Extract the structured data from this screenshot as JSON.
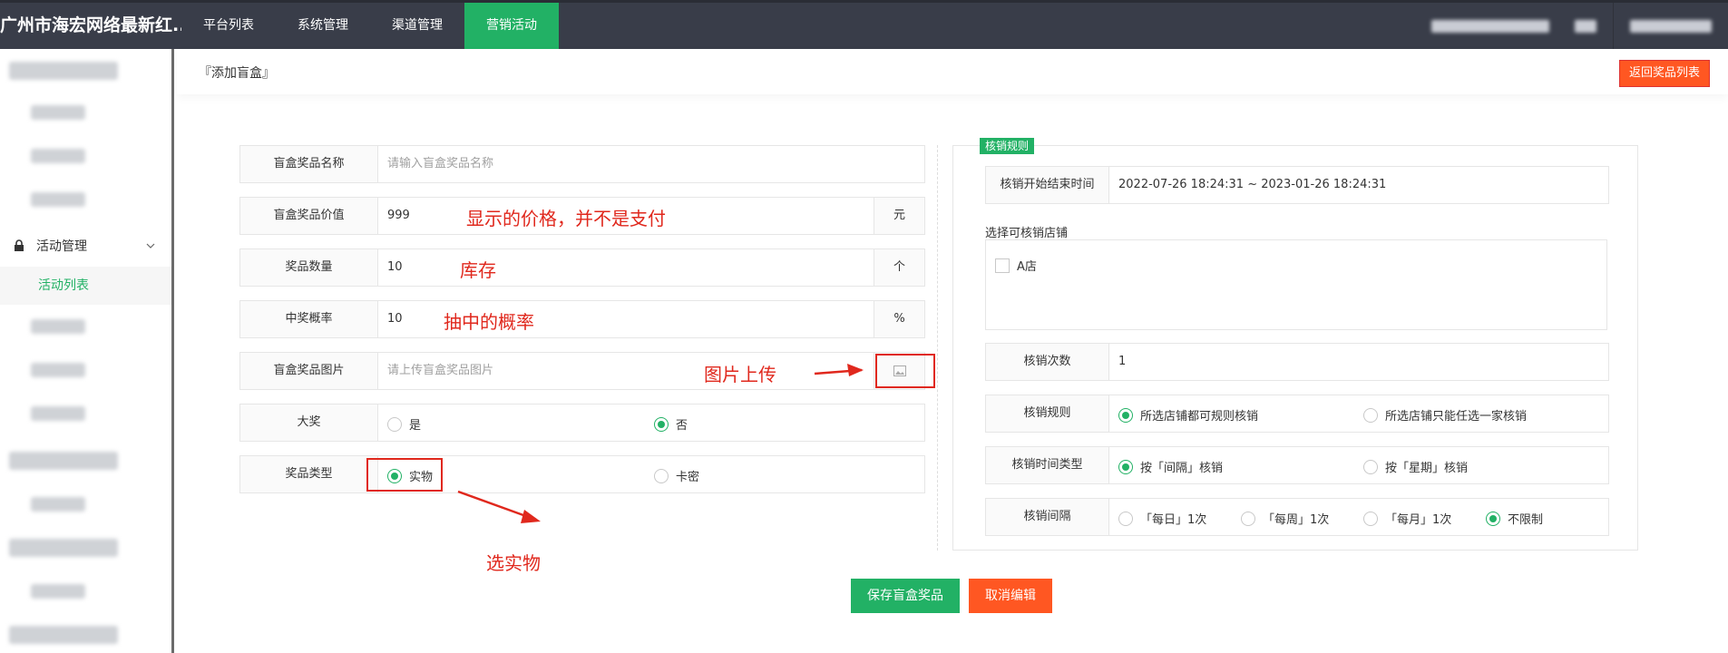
{
  "top": {
    "brand": "广州市海宏网络最新红...",
    "nav": [
      {
        "label": "平台列表"
      },
      {
        "label": "系统管理"
      },
      {
        "label": "渠道管理"
      },
      {
        "label": "营销活动"
      }
    ]
  },
  "sidebar": {
    "group_label": "活动管理",
    "active_item": "活动列表"
  },
  "header": {
    "breadcrumb": "『添加盲盒』",
    "back_button": "返回奖品列表"
  },
  "form": {
    "name": {
      "label": "盲盒奖品名称",
      "placeholder": "请输入盲盒奖品名称"
    },
    "price": {
      "label": "盲盒奖品价值",
      "value": "999",
      "unit": "元"
    },
    "quantity": {
      "label": "奖品数量",
      "value": "10",
      "unit": "个"
    },
    "probability": {
      "label": "中奖概率",
      "value": "10",
      "unit": "%"
    },
    "image": {
      "label": "盲盒奖品图片",
      "placeholder": "请上传盲盒奖品图片"
    },
    "grand_prize": {
      "label": "大奖",
      "options": [
        "是",
        "否"
      ],
      "selected": "否"
    },
    "prize_type": {
      "label": "奖品类型",
      "options": [
        "实物",
        "卡密"
      ],
      "selected": "实物"
    }
  },
  "annotations": {
    "price_note": "显示的价格，并不是支付",
    "stock_note": "库存",
    "prob_note": "抽中的概率",
    "upload_note": "图片上传",
    "type_note": "选实物"
  },
  "redeem": {
    "tag": "核销规则",
    "time": {
      "label": "核销开始结束时间",
      "value": "2022-07-26 18:24:31 ~ 2023-01-26 18:24:31"
    },
    "store_label": "选择可核销店铺",
    "store_option": "A店",
    "count": {
      "label": "核销次数",
      "value": "1"
    },
    "rule": {
      "label": "核销规则",
      "options": [
        "所选店铺都可规则核销",
        "所选店铺只能任选一家核销"
      ],
      "selected": "所选店铺都可规则核销"
    },
    "time_type": {
      "label": "核销时间类型",
      "options": [
        "按「间隔」核销",
        "按「星期」核销"
      ],
      "selected": "按「间隔」核销"
    },
    "interval": {
      "label": "核销间隔",
      "options": [
        "「每日」1次",
        "「每周」1次",
        "「每月」1次",
        "不限制"
      ],
      "selected": "不限制"
    }
  },
  "buttons": {
    "save": "保存盲盒奖品",
    "cancel": "取消编辑"
  },
  "colors": {
    "accent_green": "#22b165",
    "danger_orange": "#ff5722",
    "annotation_red": "#e0281d",
    "topbar": "#393d49"
  }
}
